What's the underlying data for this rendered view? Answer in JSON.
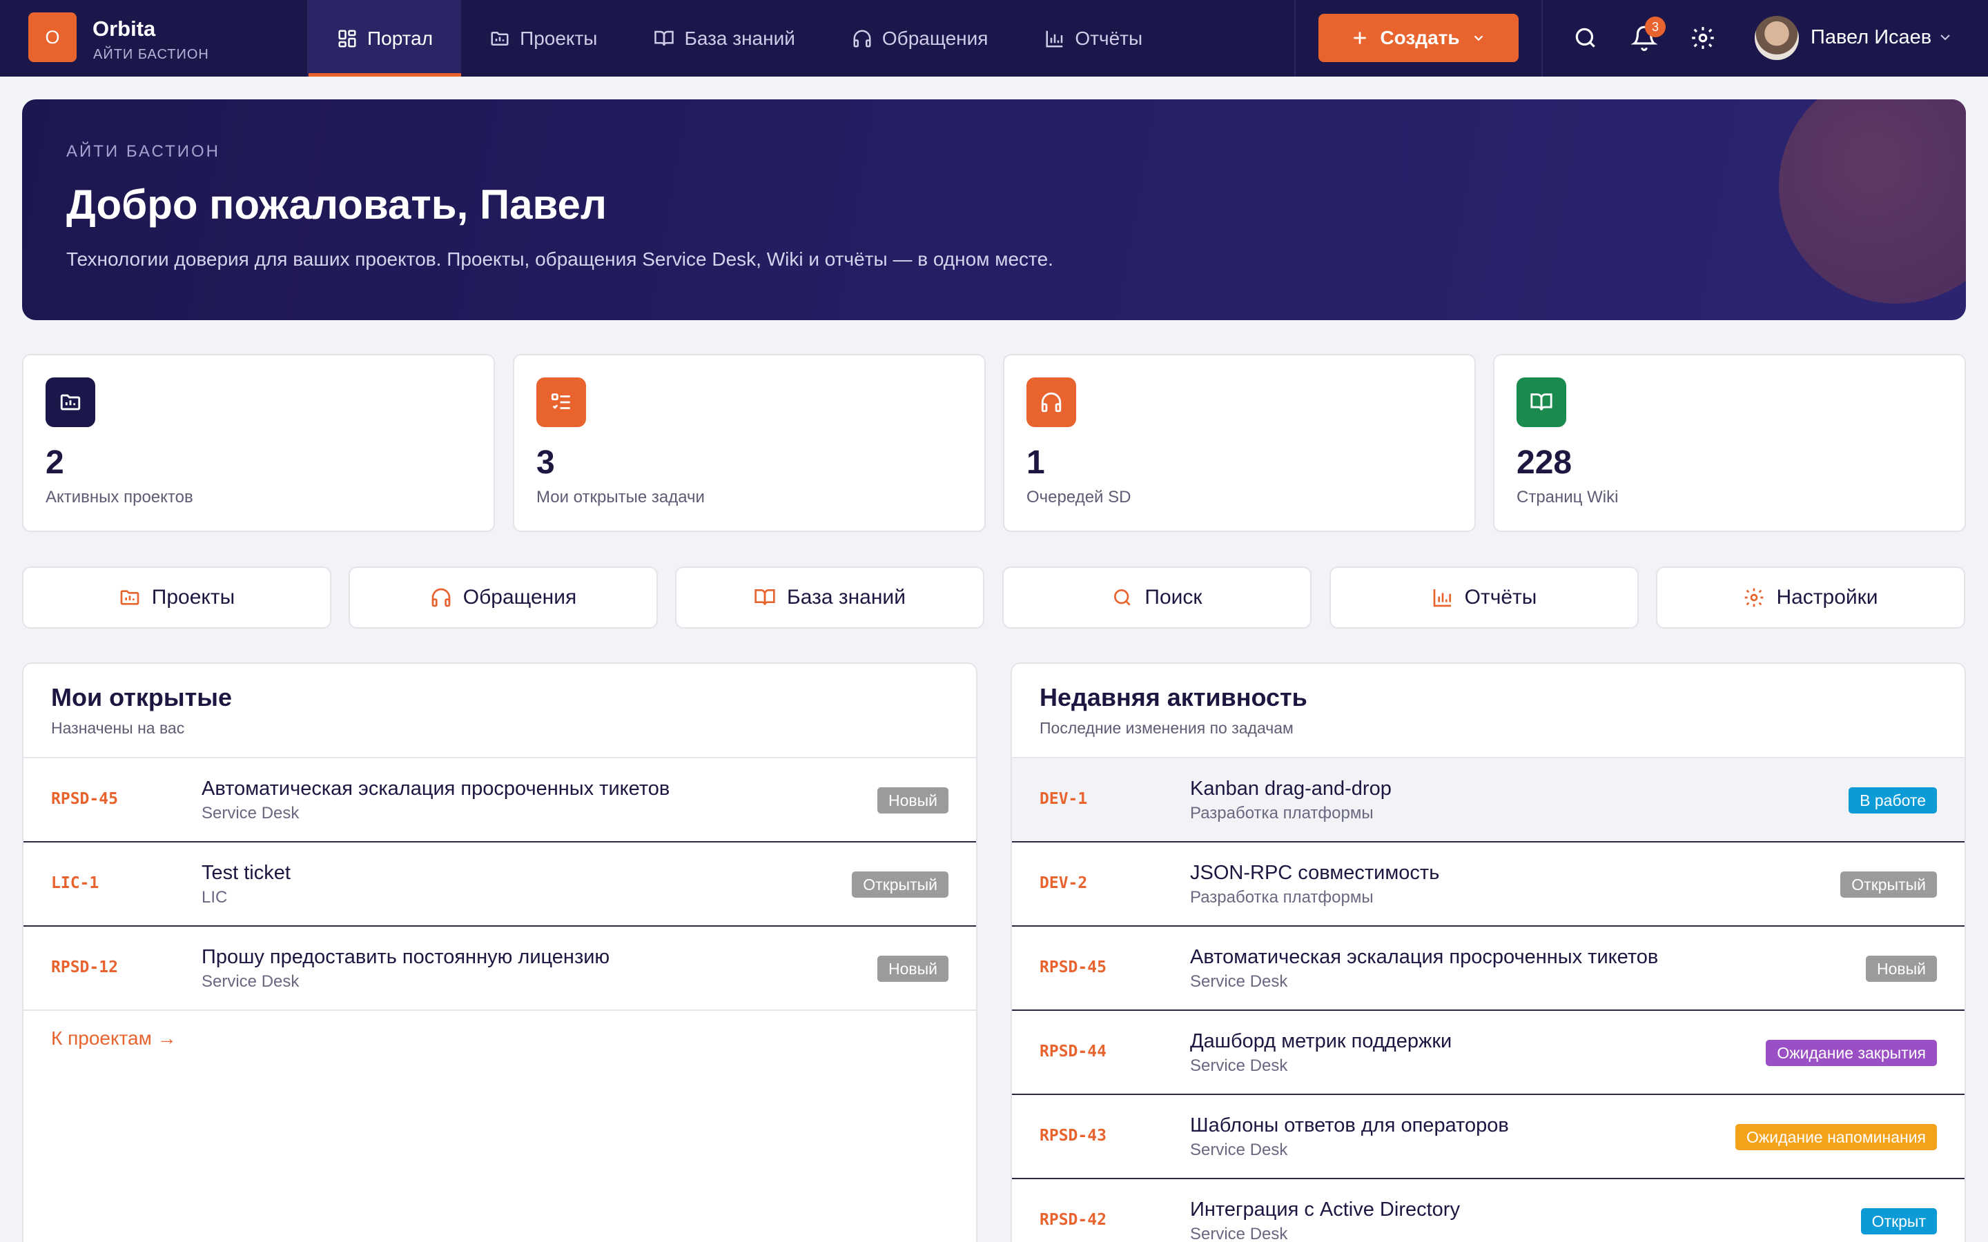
{
  "colors": {
    "accent": "#e8632e",
    "nav_bg": "#1c174a",
    "badge_gray": "#9b9b9b",
    "badge_blue": "#0d9bd8",
    "badge_purple": "#9b4fc4",
    "badge_orange": "#f3a21a",
    "icon_dark": "#1c174a",
    "icon_green": "#1b8a4f"
  },
  "header": {
    "logo_letter": "O",
    "app_name": "Orbita",
    "org": "АЙТИ БАСТИОН",
    "tabs": [
      {
        "label": "Портал",
        "icon": "grid-icon"
      },
      {
        "label": "Проекты",
        "icon": "folder-icon"
      },
      {
        "label": "База знаний",
        "icon": "book-icon"
      },
      {
        "label": "Обращения",
        "icon": "headset-icon"
      },
      {
        "label": "Отчёты",
        "icon": "bar-chart-icon"
      }
    ],
    "create_label": "Создать",
    "notifications_count": "3",
    "user_name": "Павел Исаев"
  },
  "hero": {
    "org": "АЙТИ БАСТИОН",
    "title": "Добро пожаловать, Павел",
    "subtitle": "Технологии доверия для ваших проектов. Проекты, обращения Service Desk, Wiki и отчёты — в одном месте."
  },
  "stats": [
    {
      "value": "2",
      "label": "Активных проектов",
      "icon": "folder-chart-icon"
    },
    {
      "value": "3",
      "label": "Мои открытые задачи",
      "icon": "checklist-icon"
    },
    {
      "value": "1",
      "label": "Очередей SD",
      "icon": "headset-icon"
    },
    {
      "value": "228",
      "label": "Страниц Wiki",
      "icon": "book-icon"
    }
  ],
  "quick_links": [
    {
      "label": "Проекты",
      "icon": "folder-icon"
    },
    {
      "label": "Обращения",
      "icon": "headset-icon"
    },
    {
      "label": "База знаний",
      "icon": "book-icon"
    },
    {
      "label": "Поиск",
      "icon": "search-icon"
    },
    {
      "label": "Отчёты",
      "icon": "bar-chart-icon"
    },
    {
      "label": "Настройки",
      "icon": "gear-icon"
    }
  ],
  "my_open": {
    "title": "Мои открытые",
    "subtitle": "Назначены на вас",
    "rows": [
      {
        "key": "RPSD-45",
        "title": "Автоматическая эскалация просроченных тикетов",
        "project": "Service Desk",
        "status": "Новый"
      },
      {
        "key": "LIC-1",
        "title": "Test ticket",
        "project": "LIC",
        "status": "Открытый"
      },
      {
        "key": "RPSD-12",
        "title": "Прошу предоставить постоянную лицензию",
        "project": "Service Desk",
        "status": "Новый"
      }
    ],
    "more_link": "К проектам →"
  },
  "activity": {
    "title": "Недавняя активность",
    "subtitle": "Последние изменения по задачам",
    "rows": [
      {
        "key": "DEV-1",
        "title": "Kanban drag-and-drop",
        "project": "Разработка платформы",
        "status": "В работе"
      },
      {
        "key": "DEV-2",
        "title": "JSON-RPC совместимость",
        "project": "Разработка платформы",
        "status": "Открытый"
      },
      {
        "key": "RPSD-45",
        "title": "Автоматическая эскалация просроченных тикетов",
        "project": "Service Desk",
        "status": "Новый"
      },
      {
        "key": "RPSD-44",
        "title": "Дашборд метрик поддержки",
        "project": "Service Desk",
        "status": "Ожидание закрытия"
      },
      {
        "key": "RPSD-43",
        "title": "Шаблоны ответов для операторов",
        "project": "Service Desk",
        "status": "Ожидание напоминания"
      },
      {
        "key": "RPSD-42",
        "title": "Интеграция с Active Directory",
        "project": "Service Desk",
        "status": "Открыт"
      }
    ]
  }
}
